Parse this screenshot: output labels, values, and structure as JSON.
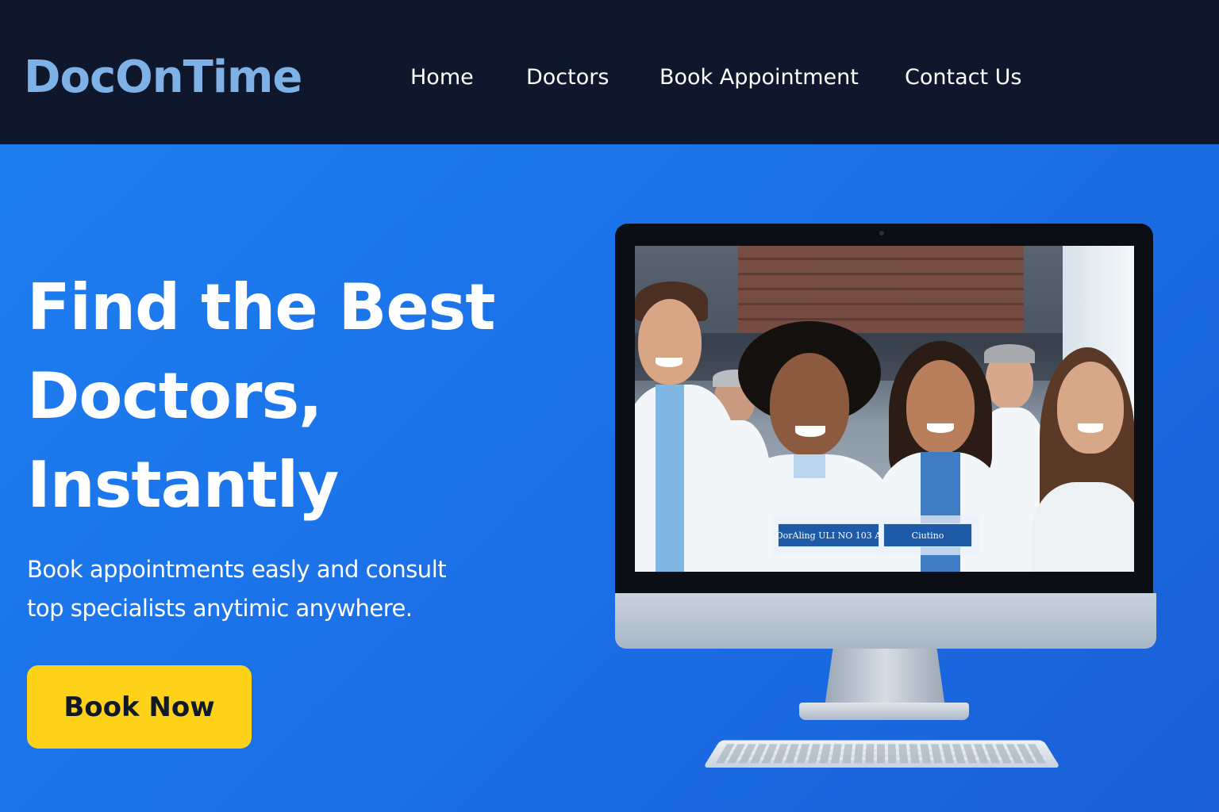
{
  "brand": {
    "name": "DocOnTime"
  },
  "nav": {
    "items": [
      {
        "label": "Home"
      },
      {
        "label": "Doctors"
      },
      {
        "label": "Book Appointment"
      },
      {
        "label": "Contact Us"
      }
    ]
  },
  "hero": {
    "title_lines": [
      "Find the Best",
      "Doctors,",
      "Instantly"
    ],
    "subtitle_lines": [
      "Book appointments easly and consult",
      "top specialists anytimic anywhere."
    ],
    "cta_label": "Book Now"
  },
  "screen": {
    "buttons": [
      {
        "label": "DorAling ULI NO 103 A"
      },
      {
        "label": "Ciutino"
      }
    ]
  },
  "colors": {
    "nav_bg": "#0e172b",
    "logo": "#7eb2e6",
    "hero_bg": "#1a6ee6",
    "cta_bg": "#ffd21a",
    "cta_text": "#111827"
  }
}
